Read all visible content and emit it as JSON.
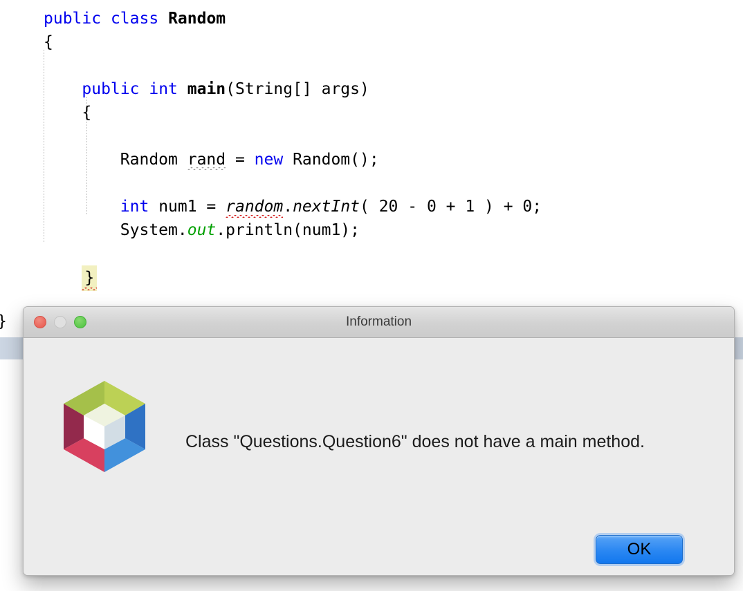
{
  "editor": {
    "language": "java",
    "lines": [
      {
        "indent": 0,
        "tokens": [
          {
            "t": "public",
            "c": "kw"
          },
          {
            "t": " ",
            "c": "plain"
          },
          {
            "t": "class",
            "c": "kw"
          },
          {
            "t": " ",
            "c": "plain"
          },
          {
            "t": "Random",
            "c": "classname"
          }
        ]
      },
      {
        "indent": 0,
        "tokens": [
          {
            "t": "{",
            "c": "plain"
          }
        ]
      },
      {
        "indent": 0,
        "tokens": []
      },
      {
        "indent": 1,
        "tokens": [
          {
            "t": "public",
            "c": "kw"
          },
          {
            "t": " ",
            "c": "plain"
          },
          {
            "t": "int",
            "c": "kw"
          },
          {
            "t": " ",
            "c": "plain"
          },
          {
            "t": "main",
            "c": "methodname"
          },
          {
            "t": "(String[] args)",
            "c": "plain"
          }
        ]
      },
      {
        "indent": 1,
        "tokens": [
          {
            "t": "{",
            "c": "plain"
          }
        ]
      },
      {
        "indent": 0,
        "tokens": []
      },
      {
        "indent": 2,
        "tokens": [
          {
            "t": "Random ",
            "c": "plain"
          },
          {
            "t": "rand",
            "c": "plain sq-gray"
          },
          {
            "t": " = ",
            "c": "plain"
          },
          {
            "t": "new",
            "c": "kw"
          },
          {
            "t": " Random();",
            "c": "plain"
          }
        ]
      },
      {
        "indent": 0,
        "tokens": []
      },
      {
        "indent": 2,
        "tokens": [
          {
            "t": "int",
            "c": "kw"
          },
          {
            "t": " num1 = ",
            "c": "plain"
          },
          {
            "t": "random",
            "c": "ital sq-red"
          },
          {
            "t": ".",
            "c": "plain"
          },
          {
            "t": "nextInt",
            "c": "ital"
          },
          {
            "t": "( 20 - 0 + 1 ) + 0;",
            "c": "plain"
          }
        ]
      },
      {
        "indent": 2,
        "tokens": [
          {
            "t": "System.",
            "c": "plain"
          },
          {
            "t": "out",
            "c": "field"
          },
          {
            "t": ".println(num1);",
            "c": "plain"
          }
        ]
      },
      {
        "indent": 0,
        "tokens": []
      },
      {
        "indent": 1,
        "tokens": [
          {
            "t": "}",
            "c": "plain brace-hl sq-red"
          }
        ]
      },
      {
        "indent": 0,
        "tokens": []
      },
      {
        "indent": 0,
        "tokens": [
          {
            "t": "}",
            "c": "plain"
          }
        ]
      }
    ],
    "offscreen_brace": "}",
    "full_text": "public class Random\n{\n\n    public int main(String[] args)\n    {\n\n        Random rand = new Random();\n\n        int num1 = random.nextInt( 20 - 0 + 1 ) + 0;\n        System.out.println(num1);\n\n    }\n\n}",
    "colors": {
      "keyword": "#0000ee",
      "field": "#00a000",
      "text": "#000000",
      "error_squiggle": "#d21b1b",
      "warning_squiggle": "#9a9a9a",
      "brace_highlight": "#f2f0c0",
      "current_line": "#ccd6e3",
      "background": "#ffffff"
    }
  },
  "dialog": {
    "title": "Information",
    "message": "Class \"Questions.Question6\" does not have a main method.",
    "icon_name": "netbeans-cube-icon",
    "traffic_lights": [
      {
        "name": "close",
        "color": "#e8564b"
      },
      {
        "name": "minimize",
        "color": "#e0e0e0"
      },
      {
        "name": "zoom",
        "color": "#4cc23e"
      }
    ],
    "buttons": [
      {
        "label": "OK",
        "default": true,
        "accent": "#2a87f2"
      }
    ],
    "background": "#ececec",
    "titlebar_background": "#d2d2d2"
  },
  "icon_colors": {
    "top_left_face": "#a5c04a",
    "top_right_face": "#bcd155",
    "left_face": "#93294c",
    "bottom_left_face": "#d8405f",
    "right_face": "#2f72c4",
    "bottom_right_face": "#4291dc",
    "inner_top": "#eff3e0",
    "inner_left": "#ffffff",
    "inner_right": "#d2dde5"
  }
}
